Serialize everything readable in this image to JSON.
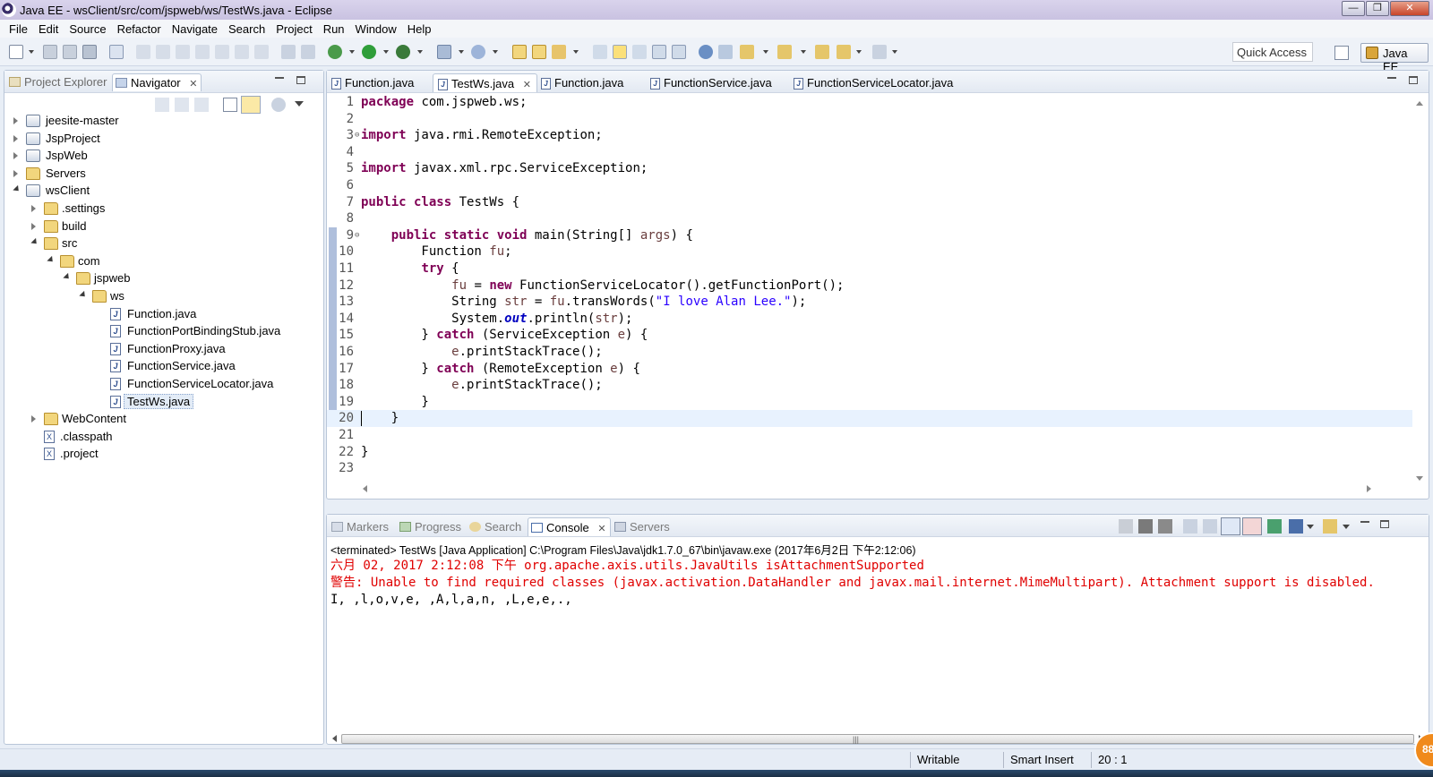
{
  "window": {
    "title": "Java EE - wsClient/src/com/jspweb/ws/TestWs.java - Eclipse",
    "minimize": "—",
    "restore": "❐",
    "close": "✕"
  },
  "menu": [
    "File",
    "Edit",
    "Source",
    "Refactor",
    "Navigate",
    "Search",
    "Project",
    "Run",
    "Window",
    "Help"
  ],
  "toolbar": {
    "quick_access_placeholder": "Quick Access",
    "perspective": "Java EE"
  },
  "left_panel": {
    "tabs": [
      {
        "label": "Project Explorer",
        "active": false
      },
      {
        "label": "Navigator",
        "active": true,
        "close": "✕"
      }
    ],
    "tree": [
      {
        "label": "jeesite-master",
        "type": "project",
        "expanded": false,
        "depth": 0
      },
      {
        "label": "JspProject",
        "type": "project",
        "expanded": false,
        "depth": 0
      },
      {
        "label": "JspWeb",
        "type": "project",
        "expanded": false,
        "depth": 0
      },
      {
        "label": "Servers",
        "type": "folder",
        "expanded": false,
        "depth": 0
      },
      {
        "label": "wsClient",
        "type": "project",
        "expanded": true,
        "depth": 0
      },
      {
        "label": ".settings",
        "type": "folder",
        "expanded": false,
        "depth": 1
      },
      {
        "label": "build",
        "type": "folder",
        "expanded": false,
        "depth": 1
      },
      {
        "label": "src",
        "type": "folder",
        "expanded": true,
        "depth": 1
      },
      {
        "label": "com",
        "type": "folder",
        "expanded": true,
        "depth": 2
      },
      {
        "label": "jspweb",
        "type": "folder",
        "expanded": true,
        "depth": 3
      },
      {
        "label": "ws",
        "type": "folder",
        "expanded": true,
        "depth": 4
      },
      {
        "label": "Function.java",
        "type": "java",
        "depth": 5
      },
      {
        "label": "FunctionPortBindingStub.java",
        "type": "java",
        "depth": 5
      },
      {
        "label": "FunctionProxy.java",
        "type": "java",
        "depth": 5
      },
      {
        "label": "FunctionService.java",
        "type": "java",
        "depth": 5
      },
      {
        "label": "FunctionServiceLocator.java",
        "type": "java",
        "depth": 5
      },
      {
        "label": "TestWs.java",
        "type": "java",
        "depth": 5,
        "selected": true
      },
      {
        "label": "WebContent",
        "type": "folder",
        "expanded": false,
        "depth": 1
      },
      {
        "label": ".classpath",
        "type": "xml",
        "depth": 1
      },
      {
        "label": ".project",
        "type": "xml",
        "depth": 1
      }
    ]
  },
  "editor": {
    "tabs": [
      {
        "label": "Function.java",
        "active": false
      },
      {
        "label": "TestWs.java",
        "active": true,
        "close": "✕"
      },
      {
        "label": "Function.java",
        "active": false
      },
      {
        "label": "FunctionService.java",
        "active": false
      },
      {
        "label": "FunctionServiceLocator.java",
        "active": false
      }
    ],
    "current_line": 20,
    "lines": [
      {
        "n": "1",
        "html": "<span class=\"kw\">package</span> com.jspweb.ws;"
      },
      {
        "n": "2",
        "html": ""
      },
      {
        "n": "3",
        "html": "<span class=\"kw\">import</span> java.rmi.RemoteException;",
        "fold": "⊖"
      },
      {
        "n": "4",
        "html": ""
      },
      {
        "n": "5",
        "html": "<span class=\"kw\">import</span> javax.xml.rpc.ServiceException;"
      },
      {
        "n": "6",
        "html": ""
      },
      {
        "n": "7",
        "html": "<span class=\"kw\">public class</span> TestWs {"
      },
      {
        "n": "8",
        "html": ""
      },
      {
        "n": "9",
        "html": "    <span class=\"kw\">public static void</span> main(String[] <span class=\"var\">args</span>) {",
        "fold": "⊖"
      },
      {
        "n": "10",
        "html": "        Function <span class=\"var\">fu</span>;"
      },
      {
        "n": "11",
        "html": "        <span class=\"kw\">try</span> {"
      },
      {
        "n": "12",
        "html": "            <span class=\"var\">fu</span> = <span class=\"kw\">new</span> FunctionServiceLocator().getFunctionPort();"
      },
      {
        "n": "13",
        "html": "            String <span class=\"var\">str</span> = <span class=\"var\">fu</span>.transWords(<span class=\"str\">\"I love Alan Lee.\"</span>);"
      },
      {
        "n": "14",
        "html": "            System.<span class=\"fld\">out</span>.println(<span class=\"var\">str</span>);"
      },
      {
        "n": "15",
        "html": "        } <span class=\"kw\">catch</span> (ServiceException <span class=\"var\">e</span>) {"
      },
      {
        "n": "16",
        "html": "            <span class=\"var\">e</span>.printStackTrace();"
      },
      {
        "n": "17",
        "html": "        } <span class=\"kw\">catch</span> (RemoteException <span class=\"var\">e</span>) {"
      },
      {
        "n": "18",
        "html": "            <span class=\"var\">e</span>.printStackTrace();"
      },
      {
        "n": "19",
        "html": "        }"
      },
      {
        "n": "20",
        "html": "    }"
      },
      {
        "n": "21",
        "html": ""
      },
      {
        "n": "22",
        "html": "}"
      },
      {
        "n": "23",
        "html": ""
      }
    ]
  },
  "console": {
    "tabs": [
      {
        "label": "Markers",
        "active": false
      },
      {
        "label": "Progress",
        "active": false
      },
      {
        "label": "Search",
        "active": false
      },
      {
        "label": "Console",
        "active": true,
        "close": "✕"
      },
      {
        "label": "Servers",
        "active": false
      }
    ],
    "terminated": "<terminated> TestWs [Java Application] C:\\Program Files\\Java\\jdk1.7.0_67\\bin\\javaw.exe (2017年6月2日 下午2:12:06)",
    "lines": [
      {
        "text": "六月 02, 2017 2:12:08 下午 org.apache.axis.utils.JavaUtils isAttachmentSupported",
        "error": true
      },
      {
        "text": "警告: Unable to find required classes (javax.activation.DataHandler and javax.mail.internet.MimeMultipart). Attachment support is disabled.",
        "error": true
      },
      {
        "text": "I, ,l,o,v,e, ,A,l,a,n, ,L,e,e,.,",
        "error": false
      }
    ]
  },
  "status": {
    "writable": "Writable",
    "insert_mode": "Smart Insert",
    "position": "20 : 1"
  },
  "badge": "88",
  "colors": {
    "keyword": "#7f0055",
    "string": "#2a00ff",
    "local_var": "#6a3e3e",
    "field": "#0000c0",
    "error": "#e00000",
    "current_line": "#e8f2fe"
  }
}
